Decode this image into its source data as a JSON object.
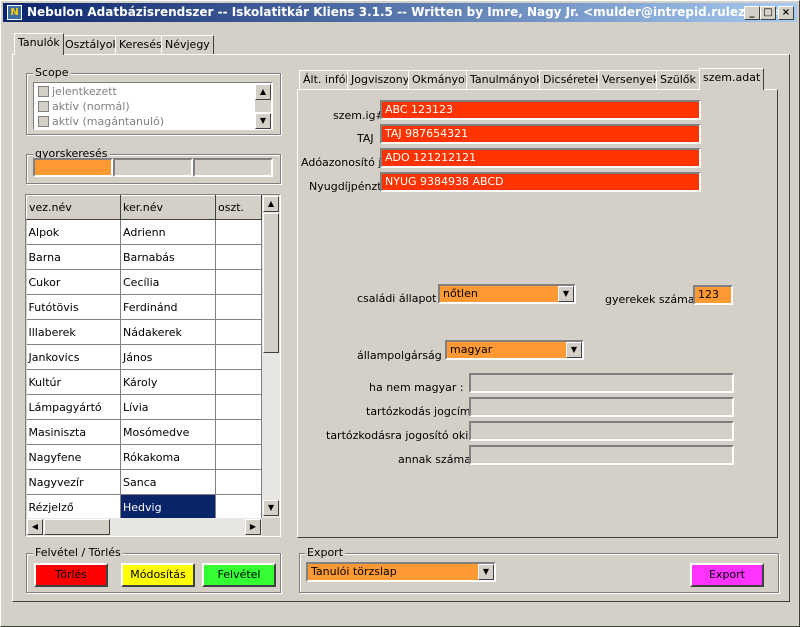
{
  "window": {
    "title": "Nebulon Adatbázisrendszer -- Iskolatitkár Kliens 3.1.5 -- Written by Imre, Nagy Jr. <mulder@intrepid.rulez.org>",
    "min": "_",
    "max": "□",
    "close": "×"
  },
  "main_tabs": [
    "Tanulók",
    "Osztályok",
    "Keresés",
    "Névjegy"
  ],
  "scope": {
    "label": "Scope",
    "items": [
      "jelentkezett",
      "aktív (normál)",
      "aktív (magántanuló)"
    ]
  },
  "quicksearch": {
    "label": "gyorskeresés",
    "values": [
      "",
      "",
      ""
    ]
  },
  "student_table": {
    "columns": [
      "vez.név",
      "ker.név",
      "oszt."
    ],
    "rows": [
      [
        "Alpok",
        "Adrienn",
        ""
      ],
      [
        "Barna",
        "Barnabás",
        ""
      ],
      [
        "Cukor",
        "Cecília",
        ""
      ],
      [
        "Futótövis",
        "Ferdinánd",
        ""
      ],
      [
        "Illaberek",
        "Nádakerek",
        ""
      ],
      [
        "Jankovics",
        "János",
        ""
      ],
      [
        "Kultúr",
        "Károly",
        ""
      ],
      [
        "Lámpagyártó",
        "Lívia",
        ""
      ],
      [
        "Masiniszta",
        "Mosómedve",
        ""
      ],
      [
        "Nagyfene",
        "Rókakoma",
        ""
      ],
      [
        "Nagyvezír",
        "Sanca",
        ""
      ],
      [
        "Rézjelző",
        "Hedvig",
        ""
      ]
    ],
    "selected_row": 11
  },
  "felvetel": {
    "label": "Felvétel / Törlés",
    "delete": "Törlés",
    "modify": "Módosítás",
    "add": "Felvétel",
    "colors": {
      "delete": "#ff0000",
      "modify": "#ffff00",
      "add": "#33ff33"
    }
  },
  "detail_tabs": [
    "Ált. infók",
    "Jogviszony",
    "Okmányok",
    "Tanulmányok",
    "Dicséretek",
    "Versenyek",
    "Szülők",
    "szem.adat"
  ],
  "personal": {
    "szemig_label": "szem.ig#",
    "szemig": "ABC 123123",
    "taj_label": "TAJ",
    "taj": "TAJ 987654321",
    "ado_label": "Adóazonosító jel",
    "ado": "ADO 121212121",
    "nyugdij_label": "Nyugdíjpénztár",
    "nyugdij": "NYUG 9384938 ABCD",
    "csaladi_label": "családi állapot",
    "csaladi": "nőtlen",
    "gyerekek_label": "gyerekek száma",
    "gyerekek": "123",
    "allampolgarsag_label": "állampolgárság",
    "allampolgarsag": "magyar",
    "hanem_label": "ha nem magyar :",
    "hanem": "",
    "tartjog_label": "tartózkodás jogcíme",
    "tartjog": "",
    "okirat_label": "tartózkodásra jogosító okirat",
    "okirat": "",
    "szama_label": "annak száma",
    "szama": ""
  },
  "export": {
    "label": "Export",
    "selected": "Tanulói törzslap",
    "button": "Export",
    "color": "#ff33ff"
  }
}
